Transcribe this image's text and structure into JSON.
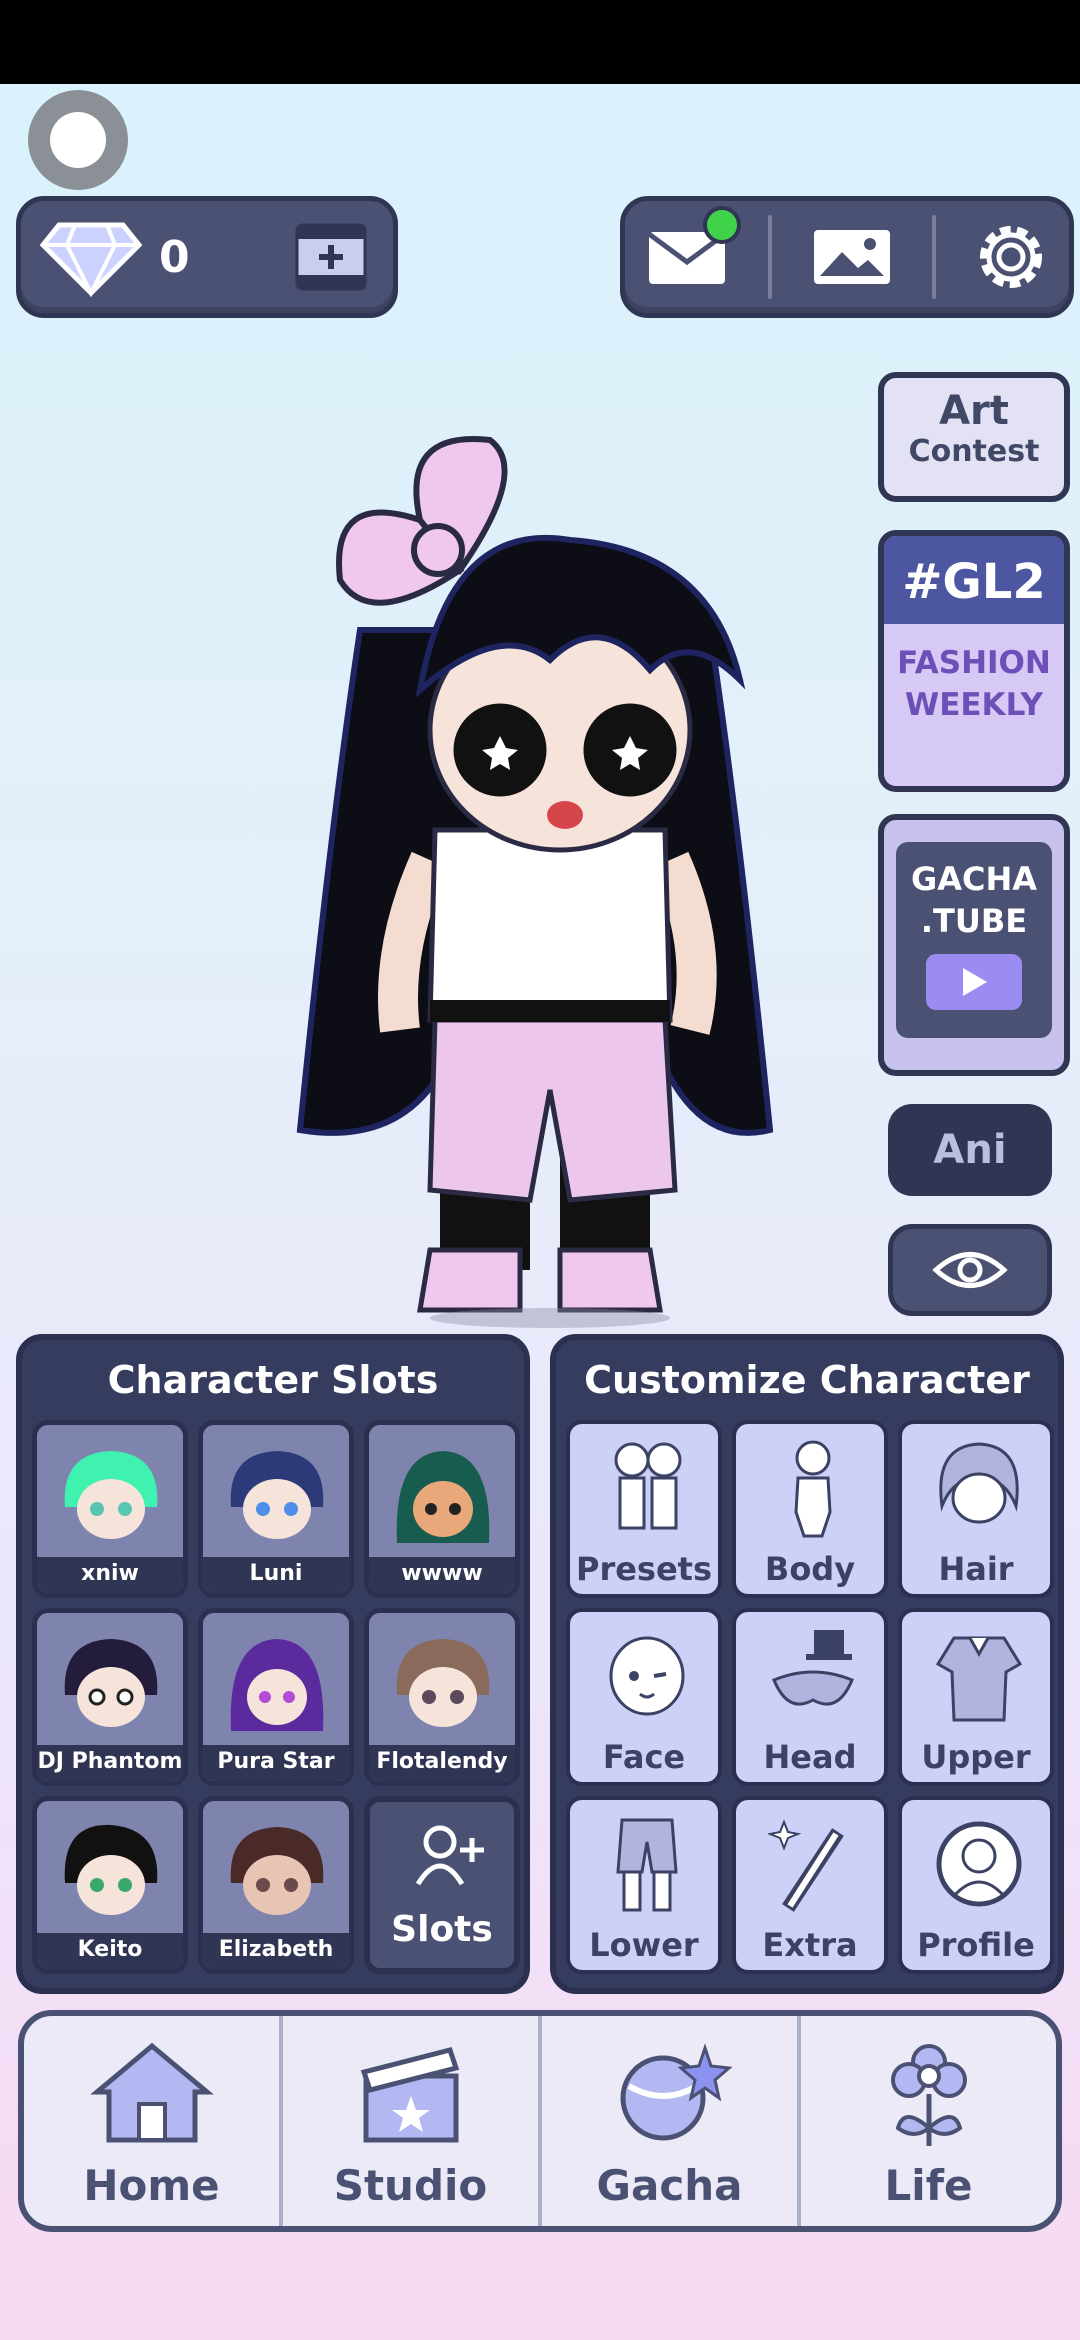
{
  "header": {
    "gems": "0"
  },
  "side_menu": {
    "art_contest_line1": "Art",
    "art_contest_line2": "Contest",
    "gl2_tag": "#GL2",
    "gl2_sub1": "FASHION",
    "gl2_sub2": "WEEKLY",
    "tube_line1": "GACHA",
    "tube_line2": ".TUBE",
    "ani": "Ani"
  },
  "slots": {
    "title": "Character Slots",
    "items": [
      {
        "name": "xniw"
      },
      {
        "name": "Luni"
      },
      {
        "name": "wwww"
      },
      {
        "name": "DJ Phantom"
      },
      {
        "name": "Pura Star"
      },
      {
        "name": "Flotalendy"
      },
      {
        "name": "Keito"
      },
      {
        "name": "Elizabeth"
      }
    ],
    "add_label": "Slots"
  },
  "customize": {
    "title": "Customize Character",
    "items": [
      {
        "label": "Presets"
      },
      {
        "label": "Body"
      },
      {
        "label": "Hair"
      },
      {
        "label": "Face"
      },
      {
        "label": "Head"
      },
      {
        "label": "Upper"
      },
      {
        "label": "Lower"
      },
      {
        "label": "Extra"
      },
      {
        "label": "Profile"
      }
    ]
  },
  "nav": {
    "items": [
      {
        "label": "Home"
      },
      {
        "label": "Studio"
      },
      {
        "label": "Gacha"
      },
      {
        "label": "Life"
      }
    ]
  },
  "colors": {
    "panel": "#4b5173",
    "panel_border": "#2f3552",
    "accent_purple": "#9a8cf0",
    "notification": "#3fd24a"
  }
}
